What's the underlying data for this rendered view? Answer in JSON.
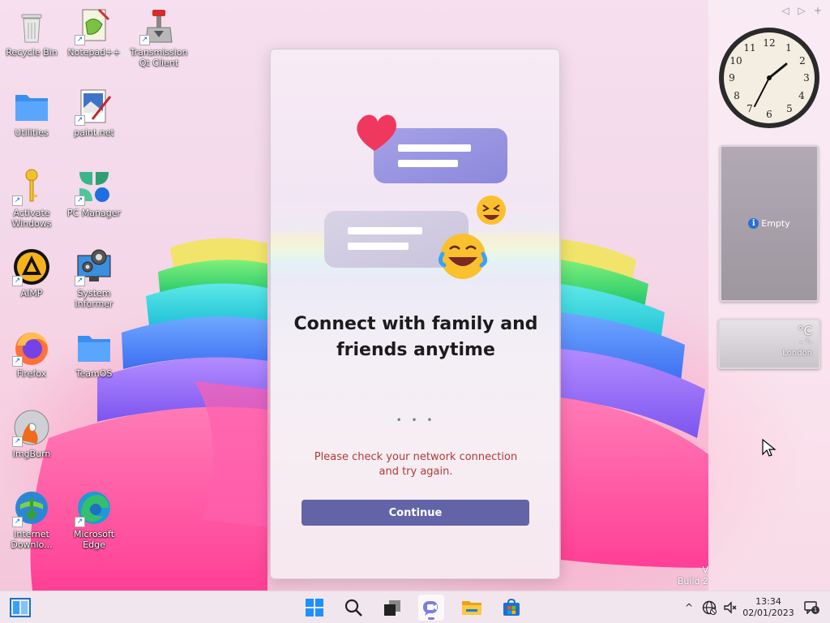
{
  "desktop": {
    "icons": [
      {
        "label": "Recycle Bin"
      },
      {
        "label": "Notepad++"
      },
      {
        "label": "Transmission Qt Client"
      },
      {
        "label": "Utilities"
      },
      {
        "label": "paint.net"
      },
      {
        "label": "Activate Windows"
      },
      {
        "label": "PC Manager"
      },
      {
        "label": "AIMP"
      },
      {
        "label": "System Informer"
      },
      {
        "label": "Firefox"
      },
      {
        "label": "TeamOS"
      },
      {
        "label": "ImgBurn"
      },
      {
        "label": "Internet Downlo..."
      },
      {
        "label": "Microsoft Edge"
      }
    ],
    "watermark_line1": "V",
    "watermark_line2": "Build 2"
  },
  "sidebar": {
    "nav_prev": "◁",
    "nav_next": "▷",
    "nav_add": "+",
    "empty_gadget_label": "Empty",
    "weather_unit": "°C",
    "weather_temp": "- °-",
    "weather_city": "London"
  },
  "dialog": {
    "title_line1": "Connect with family and",
    "title_line2": "friends anytime",
    "dots": "• • •",
    "error_message": "Please check your network connection and try again.",
    "continue_label": "Continue"
  },
  "taskbar": {
    "time": "13:34",
    "date": "02/01/2023",
    "notification_count": "1",
    "tray_chevron": "^",
    "colors": {
      "accent": "#6264a7",
      "taskbar_bg": "#f1e6ee"
    }
  }
}
